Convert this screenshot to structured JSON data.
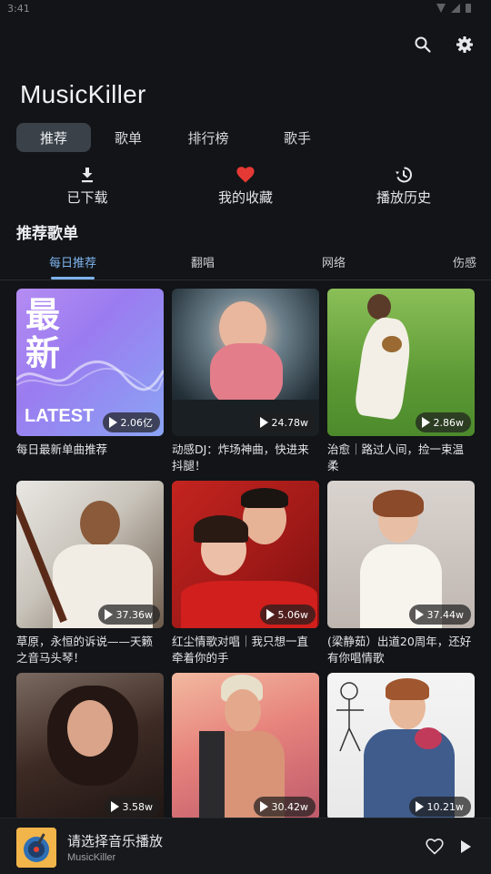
{
  "status": {
    "time": "3:41"
  },
  "app": {
    "title": "MusicKiller"
  },
  "main_tabs": [
    {
      "label": "推荐"
    },
    {
      "label": "歌单"
    },
    {
      "label": "排行榜"
    },
    {
      "label": "歌手"
    }
  ],
  "quick_actions": [
    {
      "label": "已下载",
      "icon": "download-icon"
    },
    {
      "label": "我的收藏",
      "icon": "heart-icon"
    },
    {
      "label": "播放历史",
      "icon": "history-icon"
    }
  ],
  "section": {
    "title": "推荐歌单"
  },
  "sub_tabs": [
    {
      "label": "每日推荐"
    },
    {
      "label": "翻唱"
    },
    {
      "label": "网络"
    },
    {
      "label": "伤感"
    }
  ],
  "playlists": [
    {
      "title": "每日最新单曲推荐",
      "plays": "2.06亿",
      "cover_text_1": "最",
      "cover_text_2": "新",
      "cover_text_3": "LATEST"
    },
    {
      "title": "动感DJ：炸场神曲，快进来抖腿！",
      "plays": "24.78w"
    },
    {
      "title": "治愈｜路过人间，捡一束温柔",
      "plays": "2.86w"
    },
    {
      "title": "草原，永恒的诉说——天籁之音马头琴！",
      "plays": "37.36w"
    },
    {
      "title": "红尘情歌对唱｜我只想一直牵着你的手",
      "plays": "5.06w"
    },
    {
      "title": "(梁静茹）出道20周年，还好有你唱情歌",
      "plays": "37.44w"
    },
    {
      "title": "",
      "plays": "3.58w"
    },
    {
      "title": "",
      "plays": "30.42w"
    },
    {
      "title": "",
      "plays": "10.21w"
    }
  ],
  "player": {
    "title": "请选择音乐播放",
    "subtitle": "MusicKiller"
  },
  "colors": {
    "accent": "#7fb4ef",
    "heart": "#e53935",
    "background": "#121417"
  }
}
